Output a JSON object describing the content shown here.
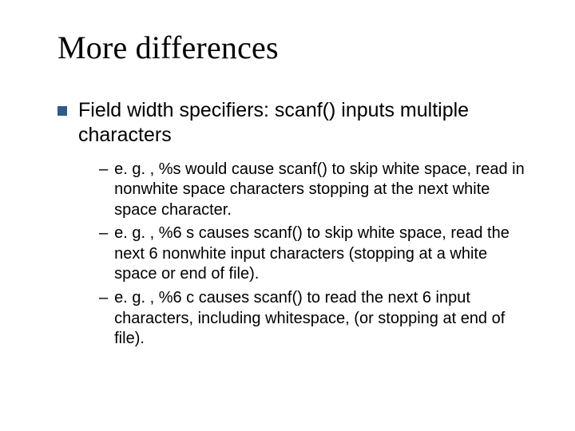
{
  "slide": {
    "title": "More differences",
    "bullet": {
      "marker_color": "#2e5b8a",
      "text": "Field width specifiers: scanf() inputs multiple characters"
    },
    "subbullets": [
      {
        "dash": "–",
        "text": "e. g. , %s would cause scanf() to skip white space, read in nonwhite space characters stopping at the next white space character."
      },
      {
        "dash": "–",
        "text": "e. g. , %6 s causes scanf() to skip white space, read the next 6 nonwhite input characters (stopping at a white space or end of file)."
      },
      {
        "dash": "–",
        "text": "e. g. , %6 c causes scanf() to read the next 6 input characters, including whitespace, (or stopping at end of file)."
      }
    ]
  }
}
